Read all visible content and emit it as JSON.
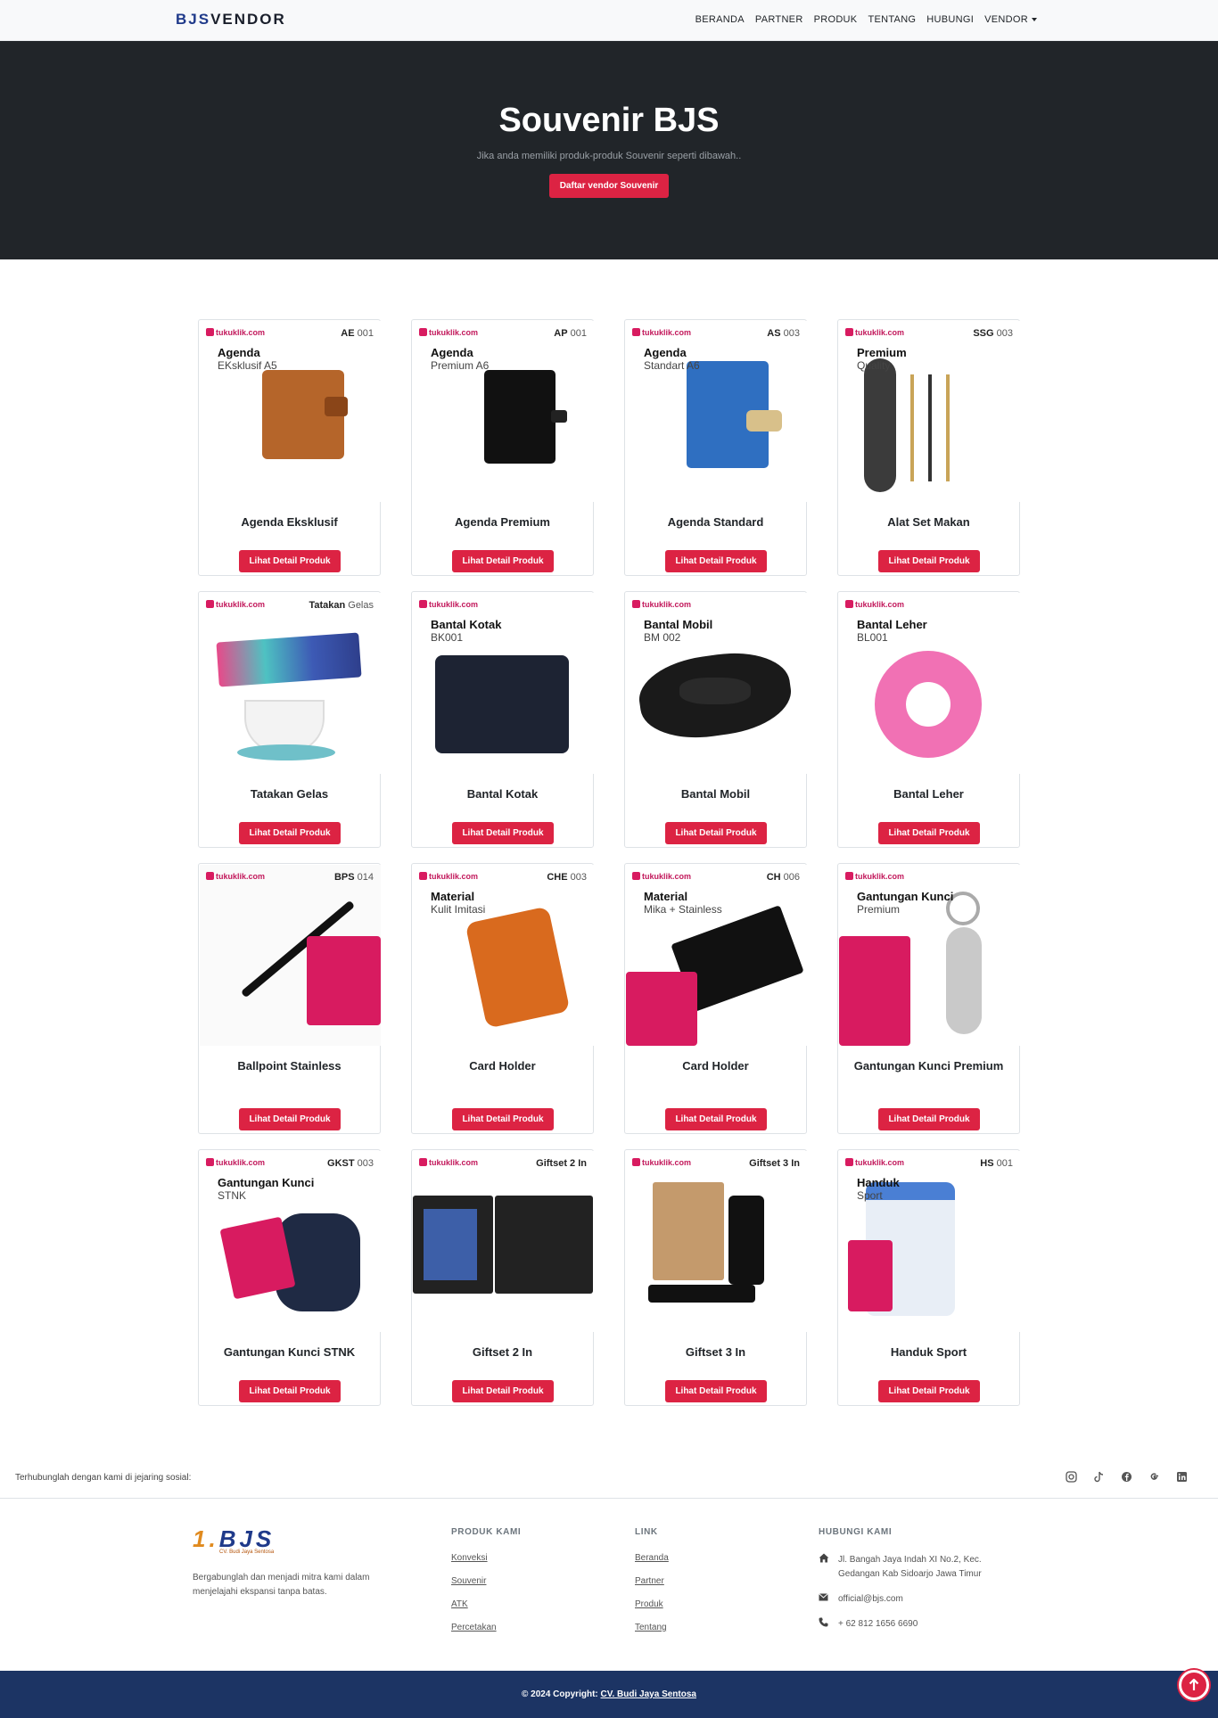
{
  "nav": {
    "brand_a": "BJS",
    "brand_b": "VENDOR",
    "items": [
      "BERANDA",
      "PARTNER",
      "PRODUK",
      "TENTANG",
      "HUBUNGI",
      "VENDOR"
    ]
  },
  "hero": {
    "title": "Souvenir BJS",
    "subtitle": "Jika anda memiliki produk-produk Souvenir seperti dibawah..",
    "button": "Daftar vendor Souvenir"
  },
  "products": [
    {
      "name": "Agenda Eksklusif",
      "code": "AE",
      "code_num": "001",
      "tag": "Agenda",
      "tag_sub": "EKsklusif A5"
    },
    {
      "name": "Agenda Premium",
      "code": "AP",
      "code_num": "001",
      "tag": "Agenda",
      "tag_sub": "Premium A6"
    },
    {
      "name": "Agenda Standard",
      "code": "AS",
      "code_num": "003",
      "tag": "Agenda",
      "tag_sub": "Standart A6"
    },
    {
      "name": "Alat Set Makan",
      "code": "SSG",
      "code_num": "003",
      "tag": "Premium",
      "tag_sub": "Quality"
    },
    {
      "name": "Tatakan Gelas",
      "code": "Tatakan",
      "code_num": "Gelas",
      "tag": "",
      "tag_sub": ""
    },
    {
      "name": "Bantal Kotak",
      "code": "",
      "code_num": "",
      "tag": "Bantal Kotak",
      "tag_sub": "BK001"
    },
    {
      "name": "Bantal Mobil",
      "code": "",
      "code_num": "",
      "tag": "Bantal Mobil",
      "tag_sub": "BM 002"
    },
    {
      "name": "Bantal Leher",
      "code": "",
      "code_num": "",
      "tag": "Bantal Leher",
      "tag_sub": "BL001"
    },
    {
      "name": "Ballpoint Stainless",
      "code": "BPS",
      "code_num": "014",
      "tag": "",
      "tag_sub": ""
    },
    {
      "name": "Card Holder",
      "code": "CHE",
      "code_num": "003",
      "tag": "Material",
      "tag_sub": "Kulit Imitasi"
    },
    {
      "name": "Card Holder",
      "code": "CH",
      "code_num": "006",
      "tag": "Material",
      "tag_sub": "Mika + Stainless"
    },
    {
      "name": "Gantungan Kunci Premium",
      "code": "",
      "code_num": "",
      "tag": "Gantungan Kunci",
      "tag_sub": "Premium"
    },
    {
      "name": "Gantungan Kunci STNK",
      "code": "GKST",
      "code_num": "003",
      "tag": "Gantungan Kunci",
      "tag_sub": "STNK"
    },
    {
      "name": "Giftset 2 In",
      "code": "Giftset 2 In",
      "code_num": "",
      "tag": "",
      "tag_sub": ""
    },
    {
      "name": "Giftset 3 In",
      "code": "Giftset 3 In",
      "code_num": "",
      "tag": "",
      "tag_sub": ""
    },
    {
      "name": "Handuk Sport",
      "code": "HS",
      "code_num": "001",
      "tag": "Handuk",
      "tag_sub": "Sport"
    }
  ],
  "product_button": "Lihat Detail Produk",
  "tuku_brand": "tukuklik.com",
  "social": {
    "text": "Terhubunglah dengan kami di jejaring sosial:",
    "icons": [
      "instagram-icon",
      "tiktok-icon",
      "facebook-icon",
      "google-icon",
      "linkedin-icon"
    ]
  },
  "footer": {
    "logo": "BJS",
    "logo_sub": "CV. Budi Jaya Sentosa",
    "desc": "Bergabunglah dan menjadi mitra kami dalam menjelajahi ekspansi tanpa batas.",
    "produk_title": "PRODUK KAMI",
    "produk": [
      "Konveksi",
      "Souvenir",
      "ATK",
      "Percetakan"
    ],
    "link_title": "LINK",
    "links": [
      "Beranda",
      "Partner",
      "Produk",
      "Tentang"
    ],
    "contact_title": "HUBUNGI KAMI",
    "address": "Jl. Bangah Jaya Indah XI No.2, Kec. Gedangan Kab Sidoarjo Jawa Timur",
    "email": "official@bjs.com",
    "phone": "+ 62 812 1656 6690"
  },
  "copyright": {
    "prefix": "© 2024 Copyright:",
    "company": "CV. Budi Jaya Sentosa"
  },
  "colors": {
    "accent": "#dc2343",
    "hero_bg": "#212529",
    "footer_bar": "#1c3464",
    "brand_blue": "#1f3a8a"
  }
}
